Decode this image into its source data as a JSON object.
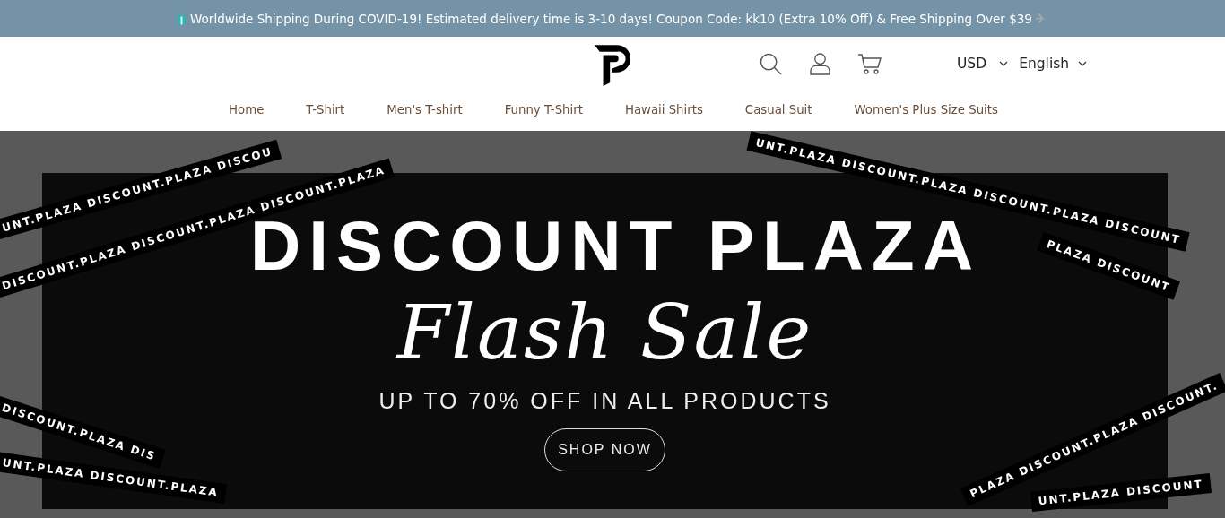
{
  "announcement": {
    "text": "Worldwide Shipping During COVID-19! Estimated delivery time is 3-10 days! Coupon Code: kk10 (Extra 10% Off) & Free Shipping Over $39"
  },
  "header": {
    "currency": "USD",
    "language": "English"
  },
  "nav": [
    {
      "label": "Home"
    },
    {
      "label": "T-Shirt"
    },
    {
      "label": "Men's T-shirt"
    },
    {
      "label": "Funny T-Shirt"
    },
    {
      "label": "Hawaii Shirts"
    },
    {
      "label": "Casual Suit"
    },
    {
      "label": "Women's Plus Size Suits"
    }
  ],
  "hero": {
    "title": "DISCOUNT PLAZA",
    "script": "Flash Sale",
    "subtitle": "UP TO 70% OFF IN ALL PRODUCTS",
    "button": "SHOP NOW",
    "tapes": [
      "UNT.PLAZA DISCOUNT.PLAZA DISCOU",
      "DISCOUNT.PLAZA DISCOUNT.PLAZA DISCOUNT.PLAZA",
      "UNT.PLAZA DISCOUNT.PLAZA DISCOUNT.PLAZA DISCOUNT",
      "PLAZA DISCOUNT",
      "DISCOUNT.PLAZA DIS",
      "UNT.PLAZA DISCOUNT.PLAZA",
      "PLAZA DISCOUNT.PLAZA DISCOUNT.",
      "UNT.PLAZA DISCOUNT"
    ]
  }
}
